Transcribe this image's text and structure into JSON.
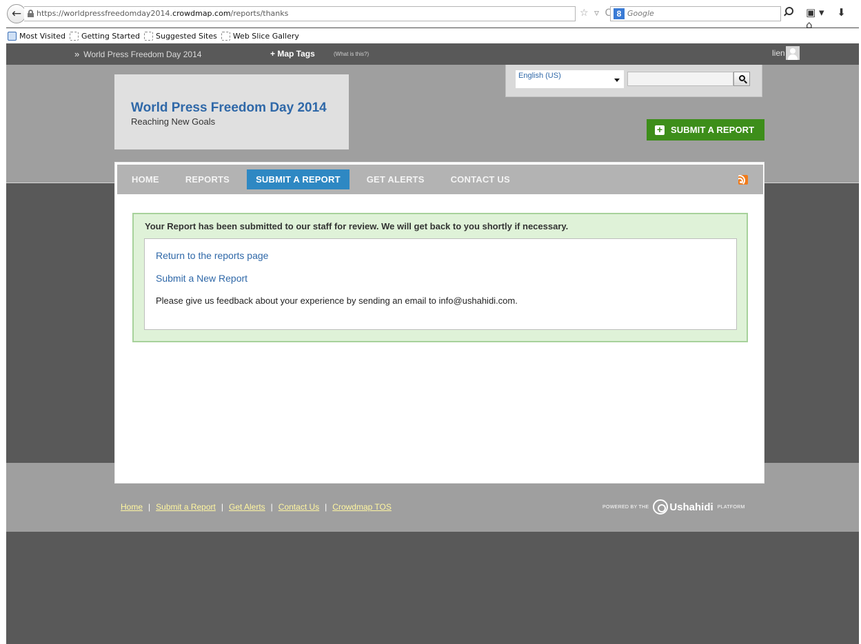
{
  "browser": {
    "url_prefix": "https://worldpressfreedomday2014.",
    "url_domain": "crowdmap.com",
    "url_path": "/reports/thanks",
    "search_engine": "Google",
    "search_badge": "8",
    "back_glyph": "←",
    "url_controls": "☆ ▿ C",
    "tool_glyphs": [
      "▣ ▾",
      "⬇",
      "⌂"
    ],
    "bookmarks": [
      {
        "label": "Most Visited",
        "icon": "most-visited-icon"
      },
      {
        "label": "Getting Started",
        "icon": "bookmark-icon"
      },
      {
        "label": "Suggested Sites",
        "icon": "bookmark-icon"
      },
      {
        "label": "Web Slice Gallery",
        "icon": "bookmark-icon"
      }
    ]
  },
  "topbar": {
    "chevron": "»",
    "deployment": "World Press Freedom Day 2014",
    "map_tags": "+ Map Tags",
    "map_tags_help": "(What is this?)",
    "user": "lien"
  },
  "header": {
    "title": "World Press Freedom Day 2014",
    "tagline": "Reaching New Goals",
    "language": "English (US)",
    "search_placeholder": "",
    "submit_label": "SUBMIT A REPORT",
    "submit_icon": "+"
  },
  "nav": {
    "items": [
      "HOME",
      "REPORTS",
      "SUBMIT A REPORT",
      "GET ALERTS",
      "CONTACT US"
    ],
    "active_index": 2
  },
  "main": {
    "success_message": "Your Report has been submitted to our staff for review. We will get back to you shortly if necessary.",
    "return_link": "Return to the reports page",
    "new_report_link": "Submit a New Report",
    "feedback": "Please give us feedback about your experience by sending an email to info@ushahidi.com."
  },
  "footer": {
    "links": [
      "Home",
      "Submit a Report",
      "Get Alerts",
      "Contact Us",
      "Crowdmap TOS"
    ],
    "separator": "|",
    "powered_pre": "POWERED BY THE",
    "brand": "Ushahidi",
    "powered_post": "PLATFORM"
  },
  "colors": {
    "page_bg": "#595959",
    "header_bg": "#9f9f9f",
    "title_blue": "#2f68a8",
    "submit_green": "#3d8e1a",
    "nav_active": "#2e88c3",
    "success_bg": "#dff2d8",
    "footer_link": "#fff6a0",
    "rss_orange": "#f07b1b"
  }
}
